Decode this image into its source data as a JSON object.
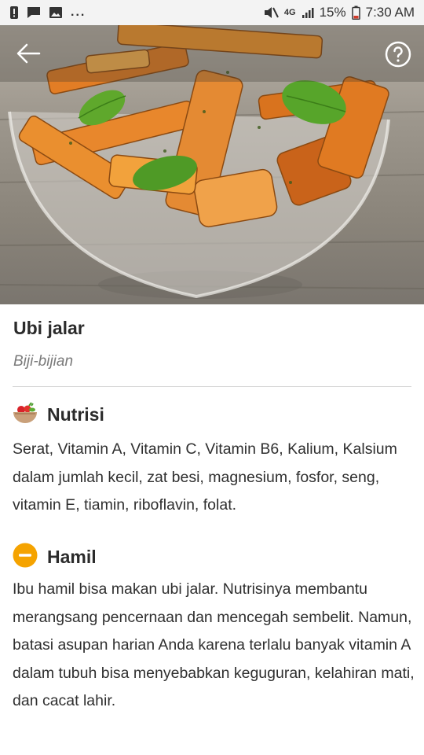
{
  "status_bar": {
    "battery_percent": "15%",
    "time": "7:30 AM",
    "network": "4G",
    "icons": [
      "alert-icon",
      "message-icon",
      "image-icon",
      "more-icon",
      "mute-icon",
      "signal-icon",
      "battery-icon"
    ],
    "more": "..."
  },
  "header": {
    "back_icon": "arrow-left-icon",
    "help_icon": "help-circle-icon"
  },
  "food": {
    "name": "Ubi jalar",
    "category": "Biji-bijian"
  },
  "sections": [
    {
      "title": "Nutrisi",
      "icon": "food-bowl-icon",
      "body": "Serat, Vitamin A, Vitamin C, Vitamin B6, Kalium, Kalsium dalam jumlah kecil, zat besi, magnesium, fosfor, seng, vitamin E, tiamin, riboflavin, folat."
    },
    {
      "title": "Hamil",
      "icon": "minus-circle-icon",
      "icon_color": "#f5a300",
      "body": "Ibu hamil bisa makan ubi jalar. Nutrisinya membantu merangsang pencernaan dan mencegah sembelit. Namun, batasi asupan harian Anda karena terlalu banyak vitamin A dalam tubuh bisa menyebabkan keguguran, kelahiran mati, dan cacat lahir."
    }
  ],
  "colors": {
    "caution": "#f5a300",
    "text": "#2b2b2b",
    "muted": "#7a7a7a"
  }
}
